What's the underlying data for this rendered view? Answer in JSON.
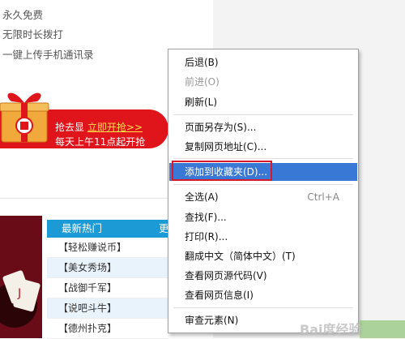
{
  "promo": {
    "lines": [
      "永久免费",
      "无限时长拨打",
      "一键上传手机通讯录"
    ],
    "banner_prefix": "抢去显",
    "banner_link": "立即开抢>>",
    "banner_line2": "每天上午11点起开抢"
  },
  "hot": {
    "title": "最新热门",
    "more": "更",
    "items": [
      "【轻松赚说币】",
      "【美女秀场】",
      "【战御千军】",
      "【说吧斗牛】",
      "【德州扑克】"
    ]
  },
  "context_menu": {
    "items": [
      {
        "label": "后退(B)",
        "disabled": false
      },
      {
        "label": "前进(O)",
        "disabled": true
      },
      {
        "label": "刷新(L)",
        "disabled": false
      },
      {
        "label": "页面另存为(S)...",
        "disabled": false
      },
      {
        "label": "复制网页地址(C)...",
        "disabled": false
      },
      {
        "label": "添加到收藏夹(D)...",
        "disabled": false,
        "highlighted": true
      },
      {
        "label": "全选(A)",
        "shortcut": "Ctrl+A",
        "disabled": false
      },
      {
        "label": "查找(F)...",
        "disabled": false
      },
      {
        "label": "打印(R)...",
        "disabled": false
      },
      {
        "label": "翻成中文（简体中文）(T)",
        "disabled": false
      },
      {
        "label": "查看网页源代码(V)",
        "disabled": false
      },
      {
        "label": "查看网页信息(I)",
        "disabled": false
      },
      {
        "label": "审查元素(N)",
        "disabled": false
      }
    ]
  },
  "watermark": "Bai度经验",
  "colors": {
    "banner_red": "#e0141b",
    "link_yellow": "#ffe14a",
    "menu_highlight": "#3a78d6",
    "hot_header_blue": "#1c9ad6",
    "callout_red": "#d7192a"
  }
}
